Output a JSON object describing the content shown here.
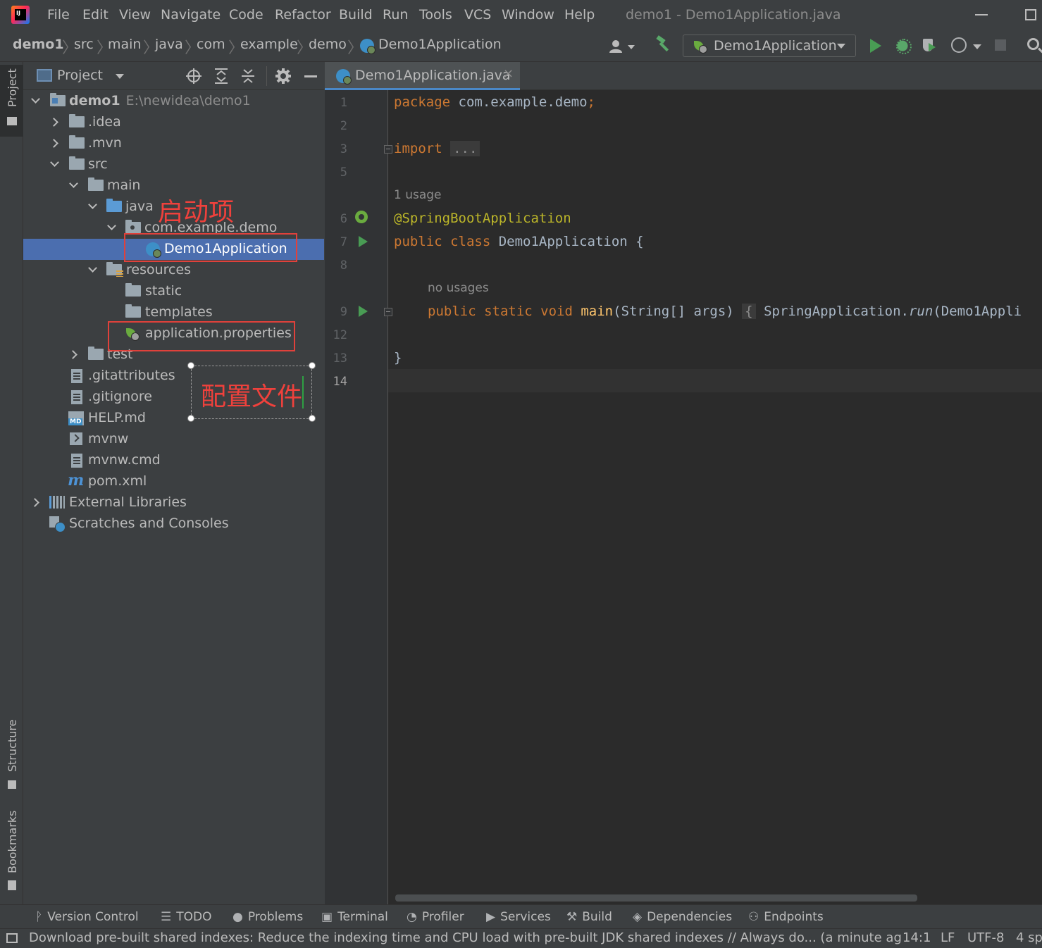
{
  "menubar": {
    "items": [
      {
        "label": "File"
      },
      {
        "label": "Edit"
      },
      {
        "label": "View"
      },
      {
        "label": "Navigate"
      },
      {
        "label": "Code"
      },
      {
        "label": "Refactor"
      },
      {
        "label": "Build"
      },
      {
        "label": "Run"
      },
      {
        "label": "Tools"
      },
      {
        "label": "VCS"
      },
      {
        "label": "Window"
      },
      {
        "label": "Help"
      }
    ],
    "window_title": "demo1 - Demo1Application.java"
  },
  "breadcrumbs": [
    "demo1",
    "src",
    "main",
    "java",
    "com",
    "example",
    "demo",
    "Demo1Application"
  ],
  "toolbar": {
    "run_config": "Demo1Application"
  },
  "left_stripe": {
    "project": "Project",
    "structure": "Structure",
    "bookmarks": "Bookmarks"
  },
  "project_panel": {
    "title": "Project",
    "tree": [
      {
        "label": "demo1",
        "path": "E:\\newidea\\demo1"
      },
      {
        "label": ".idea"
      },
      {
        "label": ".mvn"
      },
      {
        "label": "src"
      },
      {
        "label": "main"
      },
      {
        "label": "java"
      },
      {
        "label": "com.example.demo"
      },
      {
        "label": "Demo1Application"
      },
      {
        "label": "resources"
      },
      {
        "label": "static"
      },
      {
        "label": "templates"
      },
      {
        "label": "application.properties"
      },
      {
        "label": "test"
      },
      {
        "label": ".gitattributes"
      },
      {
        "label": ".gitignore"
      },
      {
        "label": "HELP.md"
      },
      {
        "label": "mvnw"
      },
      {
        "label": "mvnw.cmd"
      },
      {
        "label": "pom.xml"
      },
      {
        "label": "External Libraries"
      },
      {
        "label": "Scratches and Consoles"
      }
    ],
    "icon_badges": {
      "md": "MD",
      "maven": "m"
    }
  },
  "annotations": {
    "startup_item": "启动项",
    "config_file": "配置文件"
  },
  "editor": {
    "tab_label": "Demo1Application.java",
    "tab_close": "×",
    "line_numbers": [
      "1",
      "2",
      "3",
      "5",
      "6",
      "7",
      "8",
      "9",
      "12",
      "13",
      "14"
    ],
    "hints": {
      "usage": "1 usage",
      "no_usages": "no usages"
    },
    "code": {
      "l1_kw": "package",
      "l1_rest": " com.example.demo",
      "l1_semi": ";",
      "l3_kw": "import",
      "l3_fold": "...",
      "l6": "@SpringBootApplication",
      "l7_kw": "public class",
      "l7_rest": " Demo1Application {",
      "l9_kw": "public static void",
      "l9_fn": "main",
      "l9_args": "(String[] args)",
      "l9_brace": "{",
      "l9_body1": " SpringApplication.",
      "l9_run": "run",
      "l9_body2": "(Demo1Appli",
      "l13": "}"
    }
  },
  "bottom_tools": [
    {
      "label": "Version Control",
      "icon": "vcs-icon"
    },
    {
      "label": "TODO",
      "icon": "todo-icon"
    },
    {
      "label": "Problems",
      "icon": "problems-icon"
    },
    {
      "label": "Terminal",
      "icon": "terminal-icon"
    },
    {
      "label": "Profiler",
      "icon": "profiler-icon"
    },
    {
      "label": "Services",
      "icon": "services-icon"
    },
    {
      "label": "Build",
      "icon": "build-icon"
    },
    {
      "label": "Dependencies",
      "icon": "dependencies-icon"
    },
    {
      "label": "Endpoints",
      "icon": "endpoints-icon"
    }
  ],
  "status_bar": {
    "message": "Download pre-built shared indexes: Reduce the indexing time and CPU load with pre-built JDK shared indexes // Always do... (a minute ag",
    "position": "14:1",
    "line_sep": "LF",
    "encoding": "UTF-8",
    "indent": "4 sp"
  },
  "colors": {
    "background": "#3c3f41",
    "editor_bg": "#2b2b2b",
    "selection": "#4b6eaf",
    "keyword": "#cc7832",
    "annotation": "#bbb529",
    "method": "#ffc66d",
    "anno_red": "#e0413b",
    "run_green": "#499c54"
  }
}
